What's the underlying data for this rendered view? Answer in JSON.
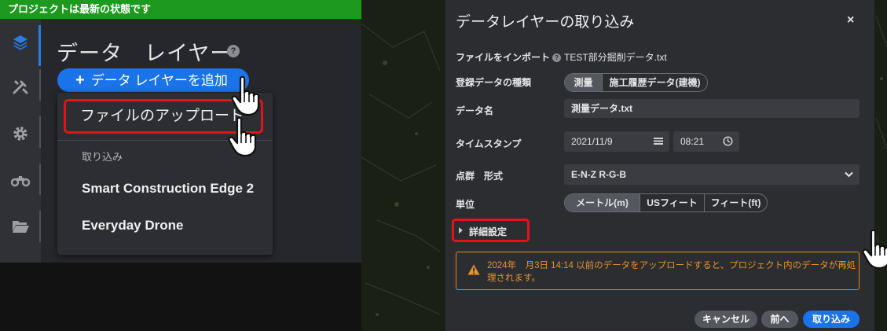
{
  "left": {
    "status_text": "プロジェクトは最新の状態です",
    "title": "データ　レイヤー",
    "help_symbol": "?",
    "add_button": {
      "plus": "+",
      "label": "データ レイヤーを追加"
    },
    "menu": {
      "upload_label": "ファイルのアップロード",
      "section_header": "取り込み",
      "items": [
        "Smart Construction Edge 2",
        "Everyday Drone"
      ]
    },
    "rail_icons": [
      "layers-icon",
      "survey-tools-icon",
      "gear-icon",
      "drone-icon",
      "folder-open-icon"
    ],
    "colors": {
      "status_bar": "#1d9a1d",
      "accent": "#1a73e8",
      "highlight": "#e3131b"
    }
  },
  "dialog": {
    "title": "データレイヤーの取り込み",
    "close_symbol": "×",
    "import_file": {
      "label": "ファイルをインポート",
      "value": "TEST部分掘削データ.txt"
    },
    "registration_type": {
      "label": "登録データの種類",
      "options": [
        "測量",
        "施工履歴データ(建機)"
      ],
      "selected": "測量"
    },
    "data_name": {
      "label": "データ名",
      "value": "測量データ.txt"
    },
    "timestamp": {
      "label": "タイムスタンプ",
      "date": "2021/11/9",
      "time": "08:21"
    },
    "point_format": {
      "label": "点群　形式",
      "value": "E-N-Z R-G-B"
    },
    "unit": {
      "label": "単位",
      "options": [
        "メートル(m)",
        "USフィート",
        "フィート(ft)"
      ],
      "selected": "メートル(m)"
    },
    "advanced_label": "詳細設定",
    "warning": "2024年　月3日 14:14 以前のデータをアップロードすると、プロジェクト内のデータが再処理されます。",
    "buttons": {
      "cancel": "キャンセル",
      "back": "前へ",
      "import": "取り込み"
    },
    "colors": {
      "warning": "#e8922a",
      "primary": "#1a73e8"
    }
  }
}
